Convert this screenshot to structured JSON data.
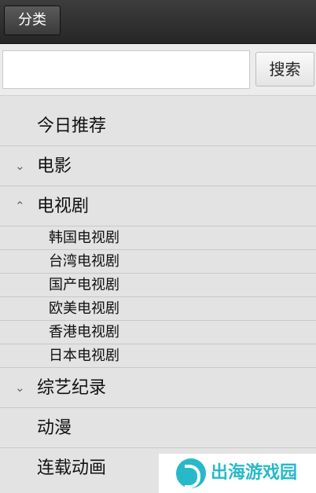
{
  "header": {
    "category_label": "分类"
  },
  "search": {
    "placeholder": "",
    "value": "",
    "button_label": "搜索"
  },
  "menu": {
    "today": "今日推荐",
    "movies": {
      "label": "电影",
      "chevron": "⌄"
    },
    "tv": {
      "label": "电视剧",
      "chevron": "⌃",
      "children": [
        "韩国电视剧",
        "台湾电视剧",
        "国产电视剧",
        "欧美电视剧",
        "香港电视剧",
        "日本电视剧"
      ]
    },
    "variety": {
      "label": "综艺纪录",
      "chevron": "⌄"
    },
    "anime": "动漫",
    "serial": "连载动画"
  },
  "watermark": {
    "text": "出海游戏园",
    "color": "#27b9c9"
  }
}
